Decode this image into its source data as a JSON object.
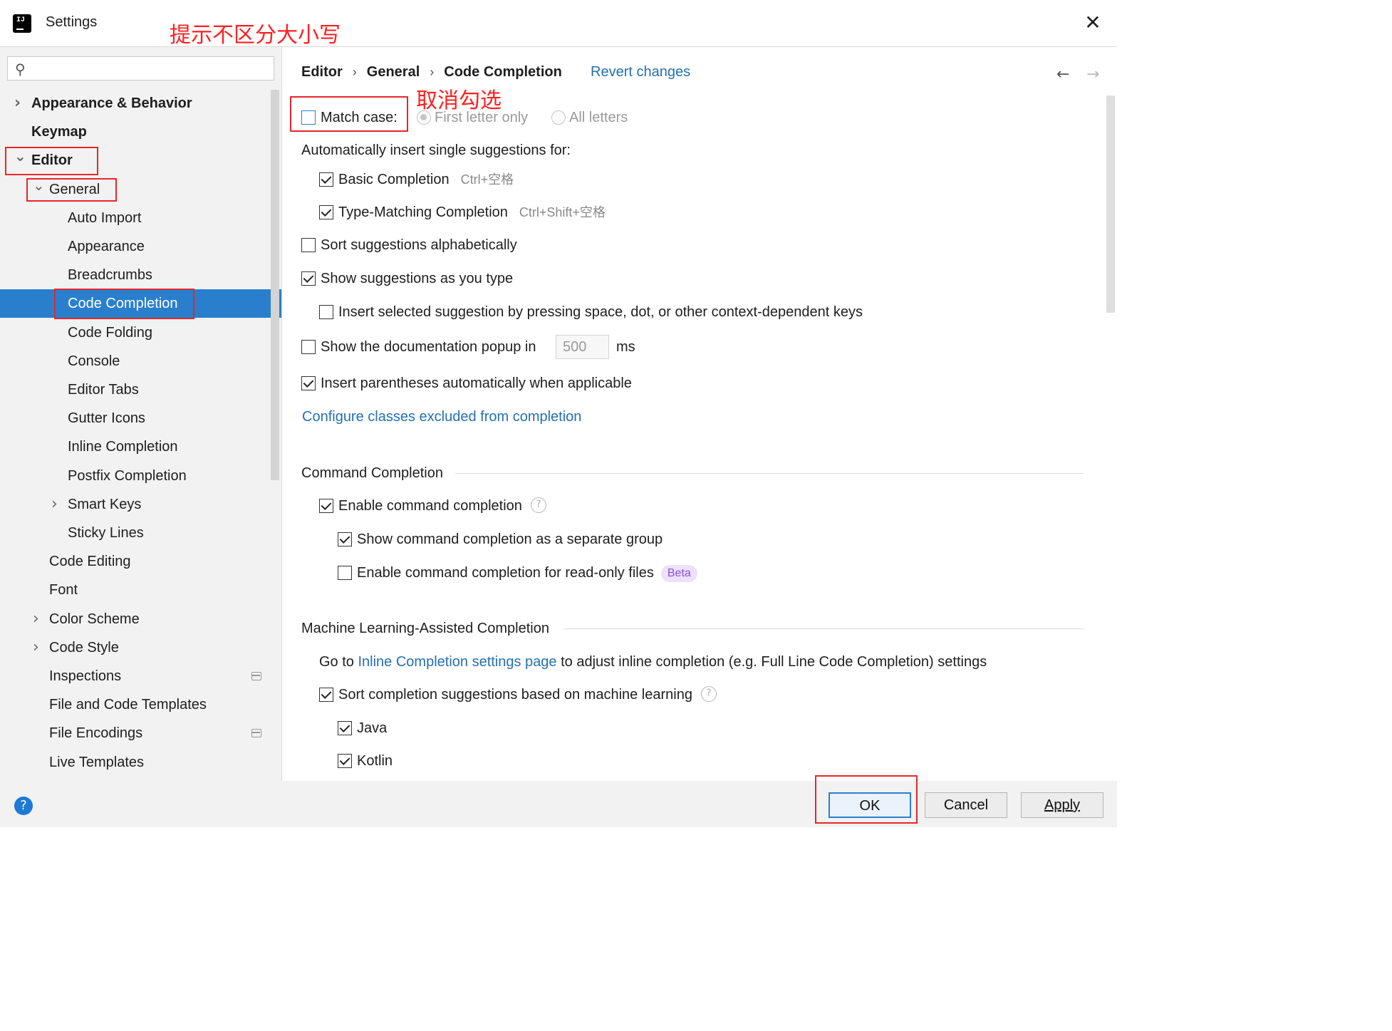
{
  "window": {
    "title": "Settings",
    "close": "✕"
  },
  "annotations": {
    "title_note": "提示不区分大小写",
    "uncheck_note": "取消勾选"
  },
  "search": {
    "value": "",
    "icon": "search-icon"
  },
  "sidebar": {
    "items": [
      {
        "label": "Appearance & Behavior",
        "level": 0,
        "expander": "collapsed"
      },
      {
        "label": "Keymap",
        "level": 0,
        "expander": "none"
      },
      {
        "label": "Editor",
        "level": 0,
        "expander": "expanded"
      },
      {
        "label": "General",
        "level": 1,
        "expander": "expanded"
      },
      {
        "label": "Auto Import",
        "level": 2,
        "expander": "none"
      },
      {
        "label": "Appearance",
        "level": 2,
        "expander": "none"
      },
      {
        "label": "Breadcrumbs",
        "level": 2,
        "expander": "none"
      },
      {
        "label": "Code Completion",
        "level": 2,
        "expander": "none",
        "selected": true
      },
      {
        "label": "Code Folding",
        "level": 2,
        "expander": "none"
      },
      {
        "label": "Console",
        "level": 2,
        "expander": "none"
      },
      {
        "label": "Editor Tabs",
        "level": 2,
        "expander": "none"
      },
      {
        "label": "Gutter Icons",
        "level": 2,
        "expander": "none"
      },
      {
        "label": "Inline Completion",
        "level": 2,
        "expander": "none"
      },
      {
        "label": "Postfix Completion",
        "level": 2,
        "expander": "none"
      },
      {
        "label": "Smart Keys",
        "level": 2,
        "expander": "collapsed"
      },
      {
        "label": "Sticky Lines",
        "level": 2,
        "expander": "none"
      },
      {
        "label": "Code Editing",
        "level": 1,
        "expander": "none"
      },
      {
        "label": "Font",
        "level": 1,
        "expander": "none"
      },
      {
        "label": "Color Scheme",
        "level": 1,
        "expander": "collapsed"
      },
      {
        "label": "Code Style",
        "level": 1,
        "expander": "collapsed"
      },
      {
        "label": "Inspections",
        "level": 1,
        "expander": "none",
        "project_icon": true
      },
      {
        "label": "File and Code Templates",
        "level": 1,
        "expander": "none"
      },
      {
        "label": "File Encodings",
        "level": 1,
        "expander": "none",
        "project_icon": true
      },
      {
        "label": "Live Templates",
        "level": 1,
        "expander": "none"
      }
    ]
  },
  "breadcrumb": {
    "items": [
      "Editor",
      "General",
      "Code Completion"
    ],
    "separator": "›",
    "revert": "Revert changes",
    "back": "←",
    "forward": "→"
  },
  "options": {
    "match_case": {
      "label": "Match case:",
      "checked": false
    },
    "radio_first": {
      "label": "First letter only",
      "selected": true,
      "enabled": false
    },
    "radio_all": {
      "label": "All letters",
      "selected": false,
      "enabled": false
    },
    "auto_insert_title": "Automatically insert single suggestions for:",
    "basic": {
      "label": "Basic Completion",
      "shortcut": "Ctrl+空格",
      "checked": true
    },
    "type_matching": {
      "label": "Type-Matching Completion",
      "shortcut": "Ctrl+Shift+空格",
      "checked": true
    },
    "sort_alpha": {
      "label": "Sort suggestions alphabetically",
      "checked": false
    },
    "show_as_type": {
      "label": "Show suggestions as you type",
      "checked": true
    },
    "insert_selected": {
      "label": "Insert selected suggestion by pressing space, dot, or other context-dependent keys",
      "checked": false
    },
    "doc_popup": {
      "label": "Show the documentation popup in",
      "value": "500",
      "unit": "ms",
      "checked": false
    },
    "insert_parens": {
      "label": "Insert parentheses automatically when applicable",
      "checked": true
    },
    "configure_link": "Configure classes excluded from completion"
  },
  "command_completion": {
    "title": "Command Completion",
    "enable": {
      "label": "Enable command completion",
      "checked": true,
      "help": "?"
    },
    "separate_group": {
      "label": "Show command completion as a separate group",
      "checked": true
    },
    "read_only": {
      "label": "Enable command completion for read-only files",
      "checked": false,
      "badge": "Beta"
    }
  },
  "ml_completion": {
    "title": "Machine Learning-Assisted Completion",
    "goto_prefix": "Go to ",
    "goto_link": "Inline Completion settings page",
    "goto_suffix": " to adjust inline completion (e.g. Full Line Code Completion) settings",
    "sort_ml": {
      "label": "Sort completion suggestions based on machine learning",
      "checked": true,
      "help": "?"
    },
    "java": {
      "label": "Java",
      "checked": true
    },
    "kotlin": {
      "label": "Kotlin",
      "checked": true
    }
  },
  "footer": {
    "help": "?",
    "ok": "OK",
    "cancel": "Cancel",
    "apply": "Apply"
  },
  "colors": {
    "selection": "#2a7fcd",
    "link": "#2470b3",
    "annotation_red": "#e8262b"
  }
}
